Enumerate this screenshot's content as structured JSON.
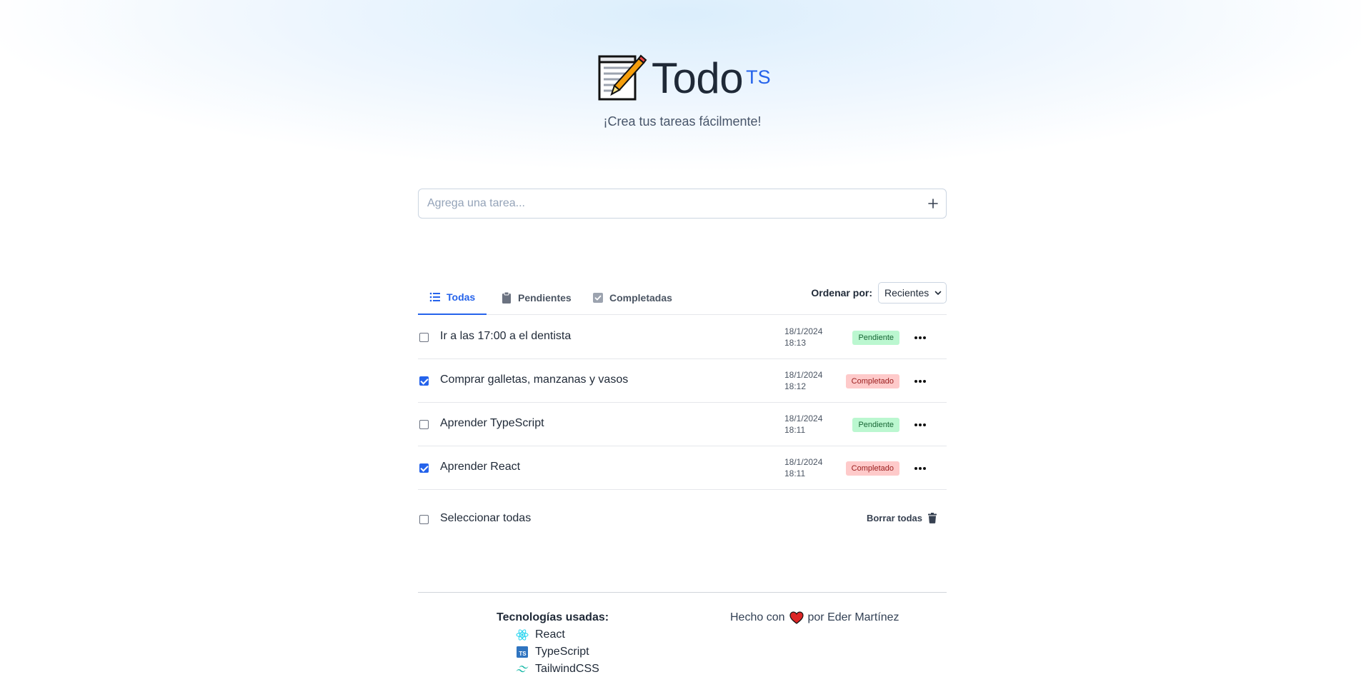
{
  "header": {
    "title": "Todo",
    "title_sup": "TS",
    "subtitle": "¡Crea tus tareas fácilmente!"
  },
  "add_task": {
    "placeholder": "Agrega una tarea...",
    "add_icon": "plus-icon"
  },
  "tabs": [
    {
      "label": "Todas",
      "icon": "list-icon",
      "active": true
    },
    {
      "label": "Pendientes",
      "icon": "clipboard-icon",
      "active": false
    },
    {
      "label": "Completadas",
      "icon": "check-square-icon",
      "active": false
    }
  ],
  "sort": {
    "label": "Ordenar por:",
    "selected": "Recientes"
  },
  "tasks": [
    {
      "text": "Ir a las 17:00 a el dentista",
      "date": "18/1/2024",
      "time": "18:13",
      "status": "Pendiente",
      "checked": false
    },
    {
      "text": "Comprar galletas, manzanas y vasos",
      "date": "18/1/2024",
      "time": "18:12",
      "status": "Completado",
      "checked": true
    },
    {
      "text": "Aprender TypeScript",
      "date": "18/1/2024",
      "time": "18:11",
      "status": "Pendiente",
      "checked": false
    },
    {
      "text": "Aprender React",
      "date": "18/1/2024",
      "time": "18:11",
      "status": "Completado",
      "checked": true
    }
  ],
  "actions": {
    "select_all": "Seleccionar todas",
    "delete_all": "Borrar todas"
  },
  "footer": {
    "tech_title": "Tecnologías usadas:",
    "technologies": [
      {
        "name": "React",
        "icon": "react-icon",
        "color": "#22d3ee"
      },
      {
        "name": "TypeScript",
        "icon": "typescript-icon",
        "color": "#2f74c0"
      },
      {
        "name": "TailwindCSS",
        "icon": "tailwind-icon",
        "color": "#14b8a6"
      }
    ],
    "made_prefix": "Hecho con",
    "made_suffix": "por Eder Martínez"
  },
  "colors": {
    "accent": "#2563eb",
    "pending_bg": "#bbf7d0",
    "done_bg": "#fecaca"
  }
}
